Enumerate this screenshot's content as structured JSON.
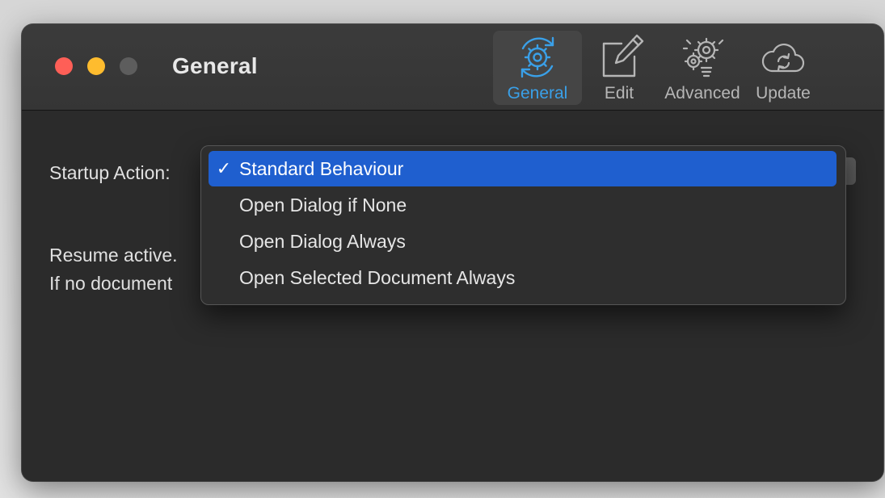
{
  "window": {
    "title": "General"
  },
  "toolbar": {
    "items": [
      {
        "label": "General",
        "icon": "gear-refresh-icon",
        "selected": true
      },
      {
        "label": "Edit",
        "icon": "pencil-square-icon",
        "selected": false
      },
      {
        "label": "Advanced",
        "icon": "gears-bulb-icon",
        "selected": false
      },
      {
        "label": "Update",
        "icon": "cloud-sync-icon",
        "selected": false
      }
    ]
  },
  "settings": {
    "startup_label": "Startup Action:",
    "description_line1": "Resume active.",
    "description_line2": "If no document"
  },
  "menu": {
    "check": "✓",
    "options": [
      {
        "label": "Standard Behaviour",
        "selected": true
      },
      {
        "label": "Open Dialog if None",
        "selected": false
      },
      {
        "label": "Open Dialog Always",
        "selected": false
      },
      {
        "label": "Open Selected Document Always",
        "selected": false
      }
    ]
  },
  "colors": {
    "accent": "#3aa0e8",
    "selection": "#1f5fcf",
    "close": "#fe5f57",
    "minimize": "#febc2e",
    "zoom_inactive": "#5d5d5d"
  }
}
